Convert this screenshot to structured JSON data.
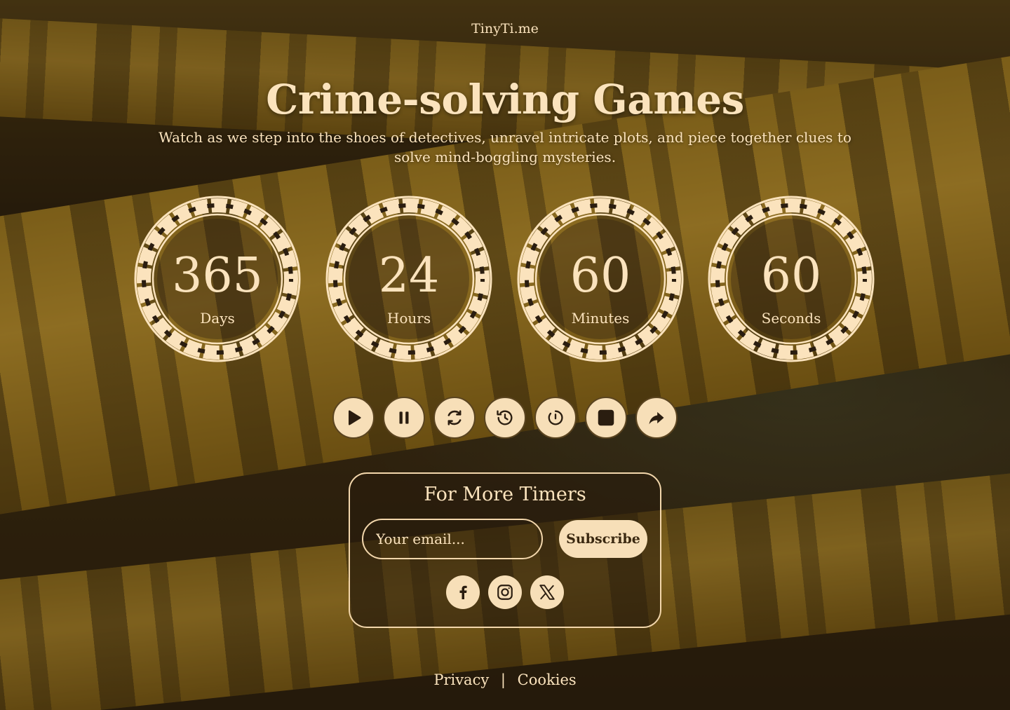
{
  "header": {
    "brand": "TinyTi.me"
  },
  "hero": {
    "title": "Crime-solving Games",
    "subtitle": "Watch as we step into the shoes of detectives, unravel intricate plots, and piece together clues to solve mind-boggling mysteries."
  },
  "timers": [
    {
      "value": "365",
      "unit": "Days"
    },
    {
      "value": "24",
      "unit": "Hours"
    },
    {
      "value": "60",
      "unit": "Minutes"
    },
    {
      "value": "60",
      "unit": "Seconds"
    }
  ],
  "controls": [
    {
      "name": "play-button",
      "icon": "play-icon"
    },
    {
      "name": "pause-button",
      "icon": "pause-icon"
    },
    {
      "name": "restart-button",
      "icon": "refresh-icon"
    },
    {
      "name": "history-button",
      "icon": "history-icon"
    },
    {
      "name": "timer-reset-button",
      "icon": "timer-icon"
    },
    {
      "name": "stop-button",
      "icon": "stop-icon"
    },
    {
      "name": "share-button",
      "icon": "share-icon"
    }
  ],
  "subscribe": {
    "title": "For More Timers",
    "email_placeholder": "Your email...",
    "button_label": "Subscribe"
  },
  "socials": [
    "facebook-icon",
    "instagram-icon",
    "x-icon"
  ],
  "footer": {
    "privacy": "Privacy",
    "separator": "|",
    "cookies": "Cookies"
  },
  "colors": {
    "cream": "#fbe3bd",
    "dark": "#2a1d10",
    "tape": "#d2a332"
  }
}
